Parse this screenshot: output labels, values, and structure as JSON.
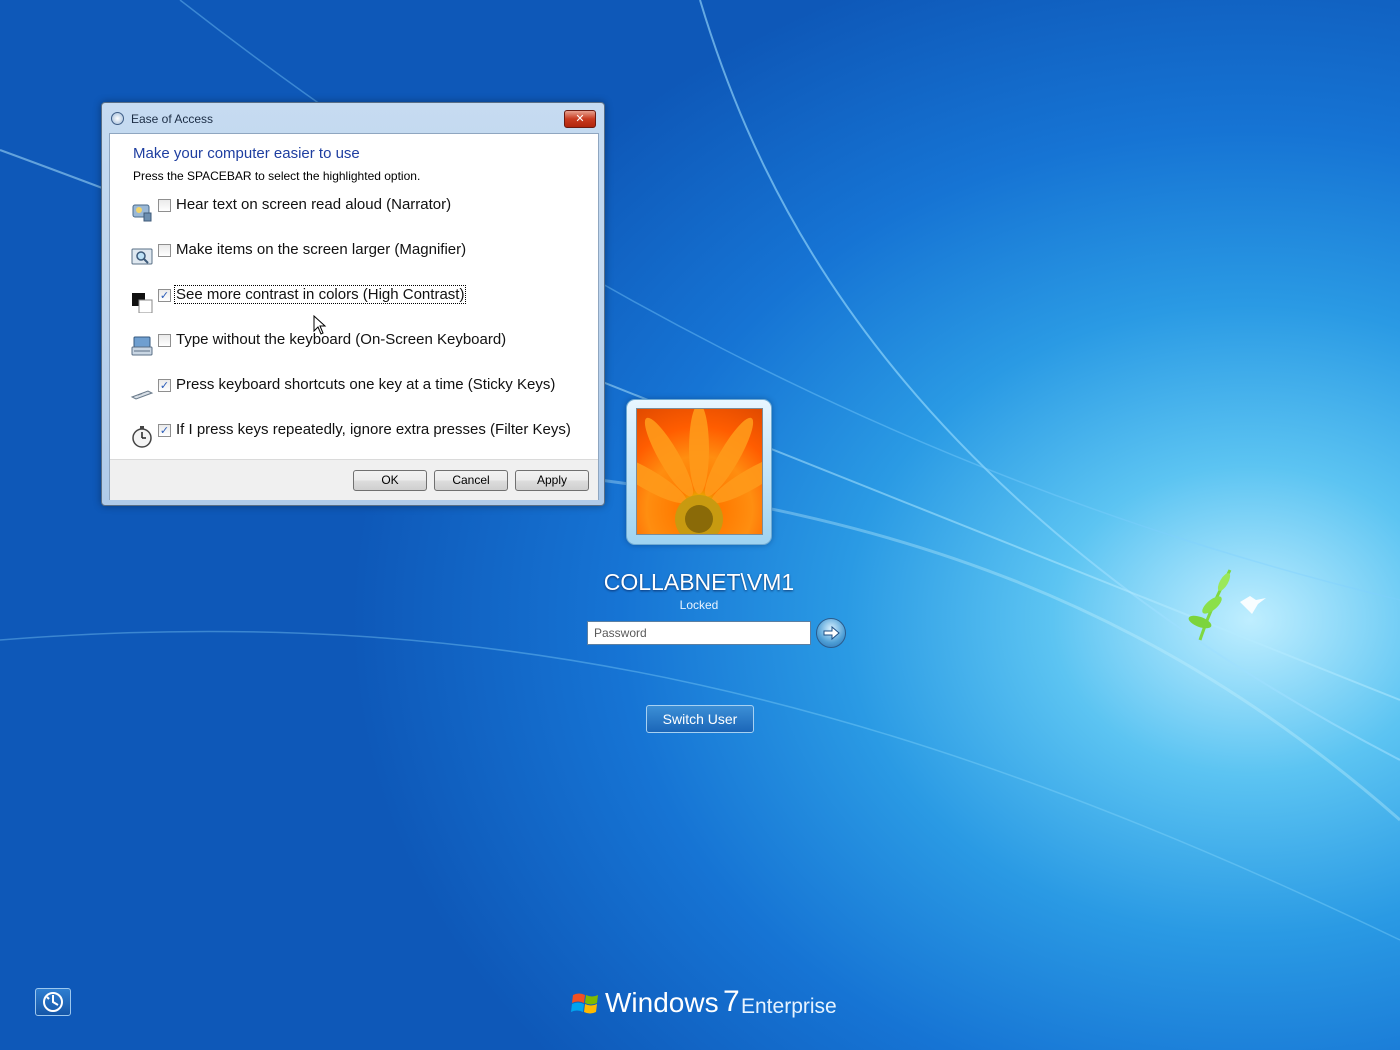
{
  "dialog": {
    "title": "Ease of Access",
    "close_label": "✕",
    "heading": "Make your computer easier to use",
    "instruction": "Press the SPACEBAR to select the highlighted option.",
    "options": [
      {
        "label": "Hear text on screen read aloud (Narrator)",
        "checked": false,
        "icon": "narrator-icon"
      },
      {
        "label": "Make items on the screen larger (Magnifier)",
        "checked": false,
        "icon": "magnifier-icon"
      },
      {
        "label": "See more contrast in colors (High Contrast)",
        "checked": true,
        "focused": true,
        "icon": "high-contrast-icon"
      },
      {
        "label": "Type without the keyboard (On-Screen Keyboard)",
        "checked": false,
        "icon": "keyboard-icon"
      },
      {
        "label": "Press keyboard shortcuts one key at a time (Sticky Keys)",
        "checked": true,
        "icon": "sticky-keys-icon"
      },
      {
        "label": "If I press keys repeatedly, ignore extra presses (Filter Keys)",
        "checked": true,
        "icon": "filter-keys-icon"
      }
    ],
    "buttons": {
      "ok": "OK",
      "cancel": "Cancel",
      "apply": "Apply"
    }
  },
  "logon": {
    "username": "COLLABNET\\VM1",
    "status": "Locked",
    "password_placeholder": "Password",
    "switch_user": "Switch User"
  },
  "branding": {
    "word": "Windows",
    "version": "7",
    "edition": "Enterprise"
  },
  "colors": {
    "accent_blue": "#1e3ea0",
    "background": "#1674d4"
  }
}
